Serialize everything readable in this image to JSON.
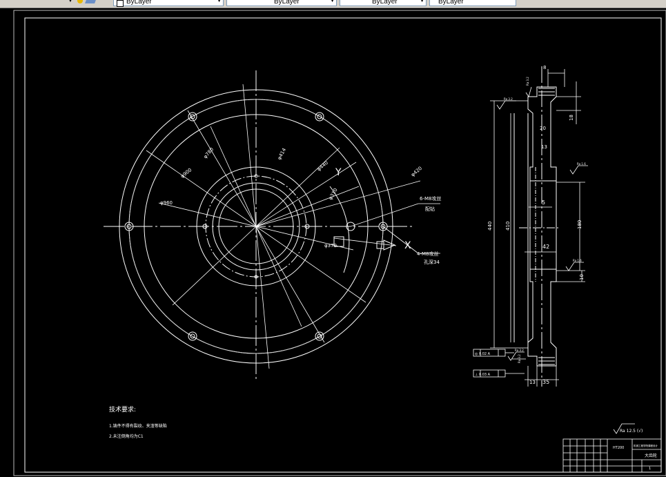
{
  "toolbar": {
    "layer_combo": {
      "value": "ByLayer"
    },
    "color_combo": {
      "value": "ByLayer"
    },
    "linetype_combo": {
      "value": "ByLayer"
    },
    "lineweight_combo": {
      "value": "ByLayer"
    }
  },
  "colors": {
    "background": "#000000",
    "geometry": "#ffffff",
    "toolbar": "#d4d0c8"
  },
  "drawing": {
    "front_view": {
      "dims": {
        "d960": "φ960",
        "d900": "φ900",
        "d780": "φ780",
        "d414": "φ414",
        "d440": "φ440",
        "d420": "φ420",
        "d310": "φ310",
        "d370": "φ370"
      },
      "callouts": {
        "holes_6": "6-M8攻丝",
        "holes_6_b": "配钻",
        "holes_4": "4-M8攻丝",
        "holes_4_b": "孔深34"
      },
      "view_marks": {
        "x_mark": "X",
        "y_mark": "Y"
      }
    },
    "section_view": {
      "dims": {
        "top_width": "8",
        "flange_right": "18",
        "d20": "20",
        "d13": "13",
        "d5": "5",
        "d42": "42",
        "d180": "180",
        "d440": "440",
        "d410": "410",
        "d10": "10",
        "bottom_13": "13",
        "bottom_35": "35"
      },
      "roughness": {
        "r1": "Ra 3.2",
        "r2": "Ra 3.2",
        "r3": "Ra 1.6",
        "r4": "Ra 1.6",
        "r5": "Ra 3.2",
        "r6": "Ra 3.2"
      },
      "tolerances": {
        "t1": "◎ 0.02 A",
        "t2": "⊥ 0.03 A"
      }
    },
    "technical_requirements": {
      "title": "技术要求:",
      "items": [
        "1.铸件不得有裂纹、夹渣等缺陷",
        "2.未注倒角均为C1"
      ]
    },
    "general_roughness": "Ra 12.5 (√)",
    "title_block": {
      "material": "HT200",
      "school": "机械工程学院课程设计",
      "part_name": "大齿轮",
      "sheet": "1"
    }
  }
}
